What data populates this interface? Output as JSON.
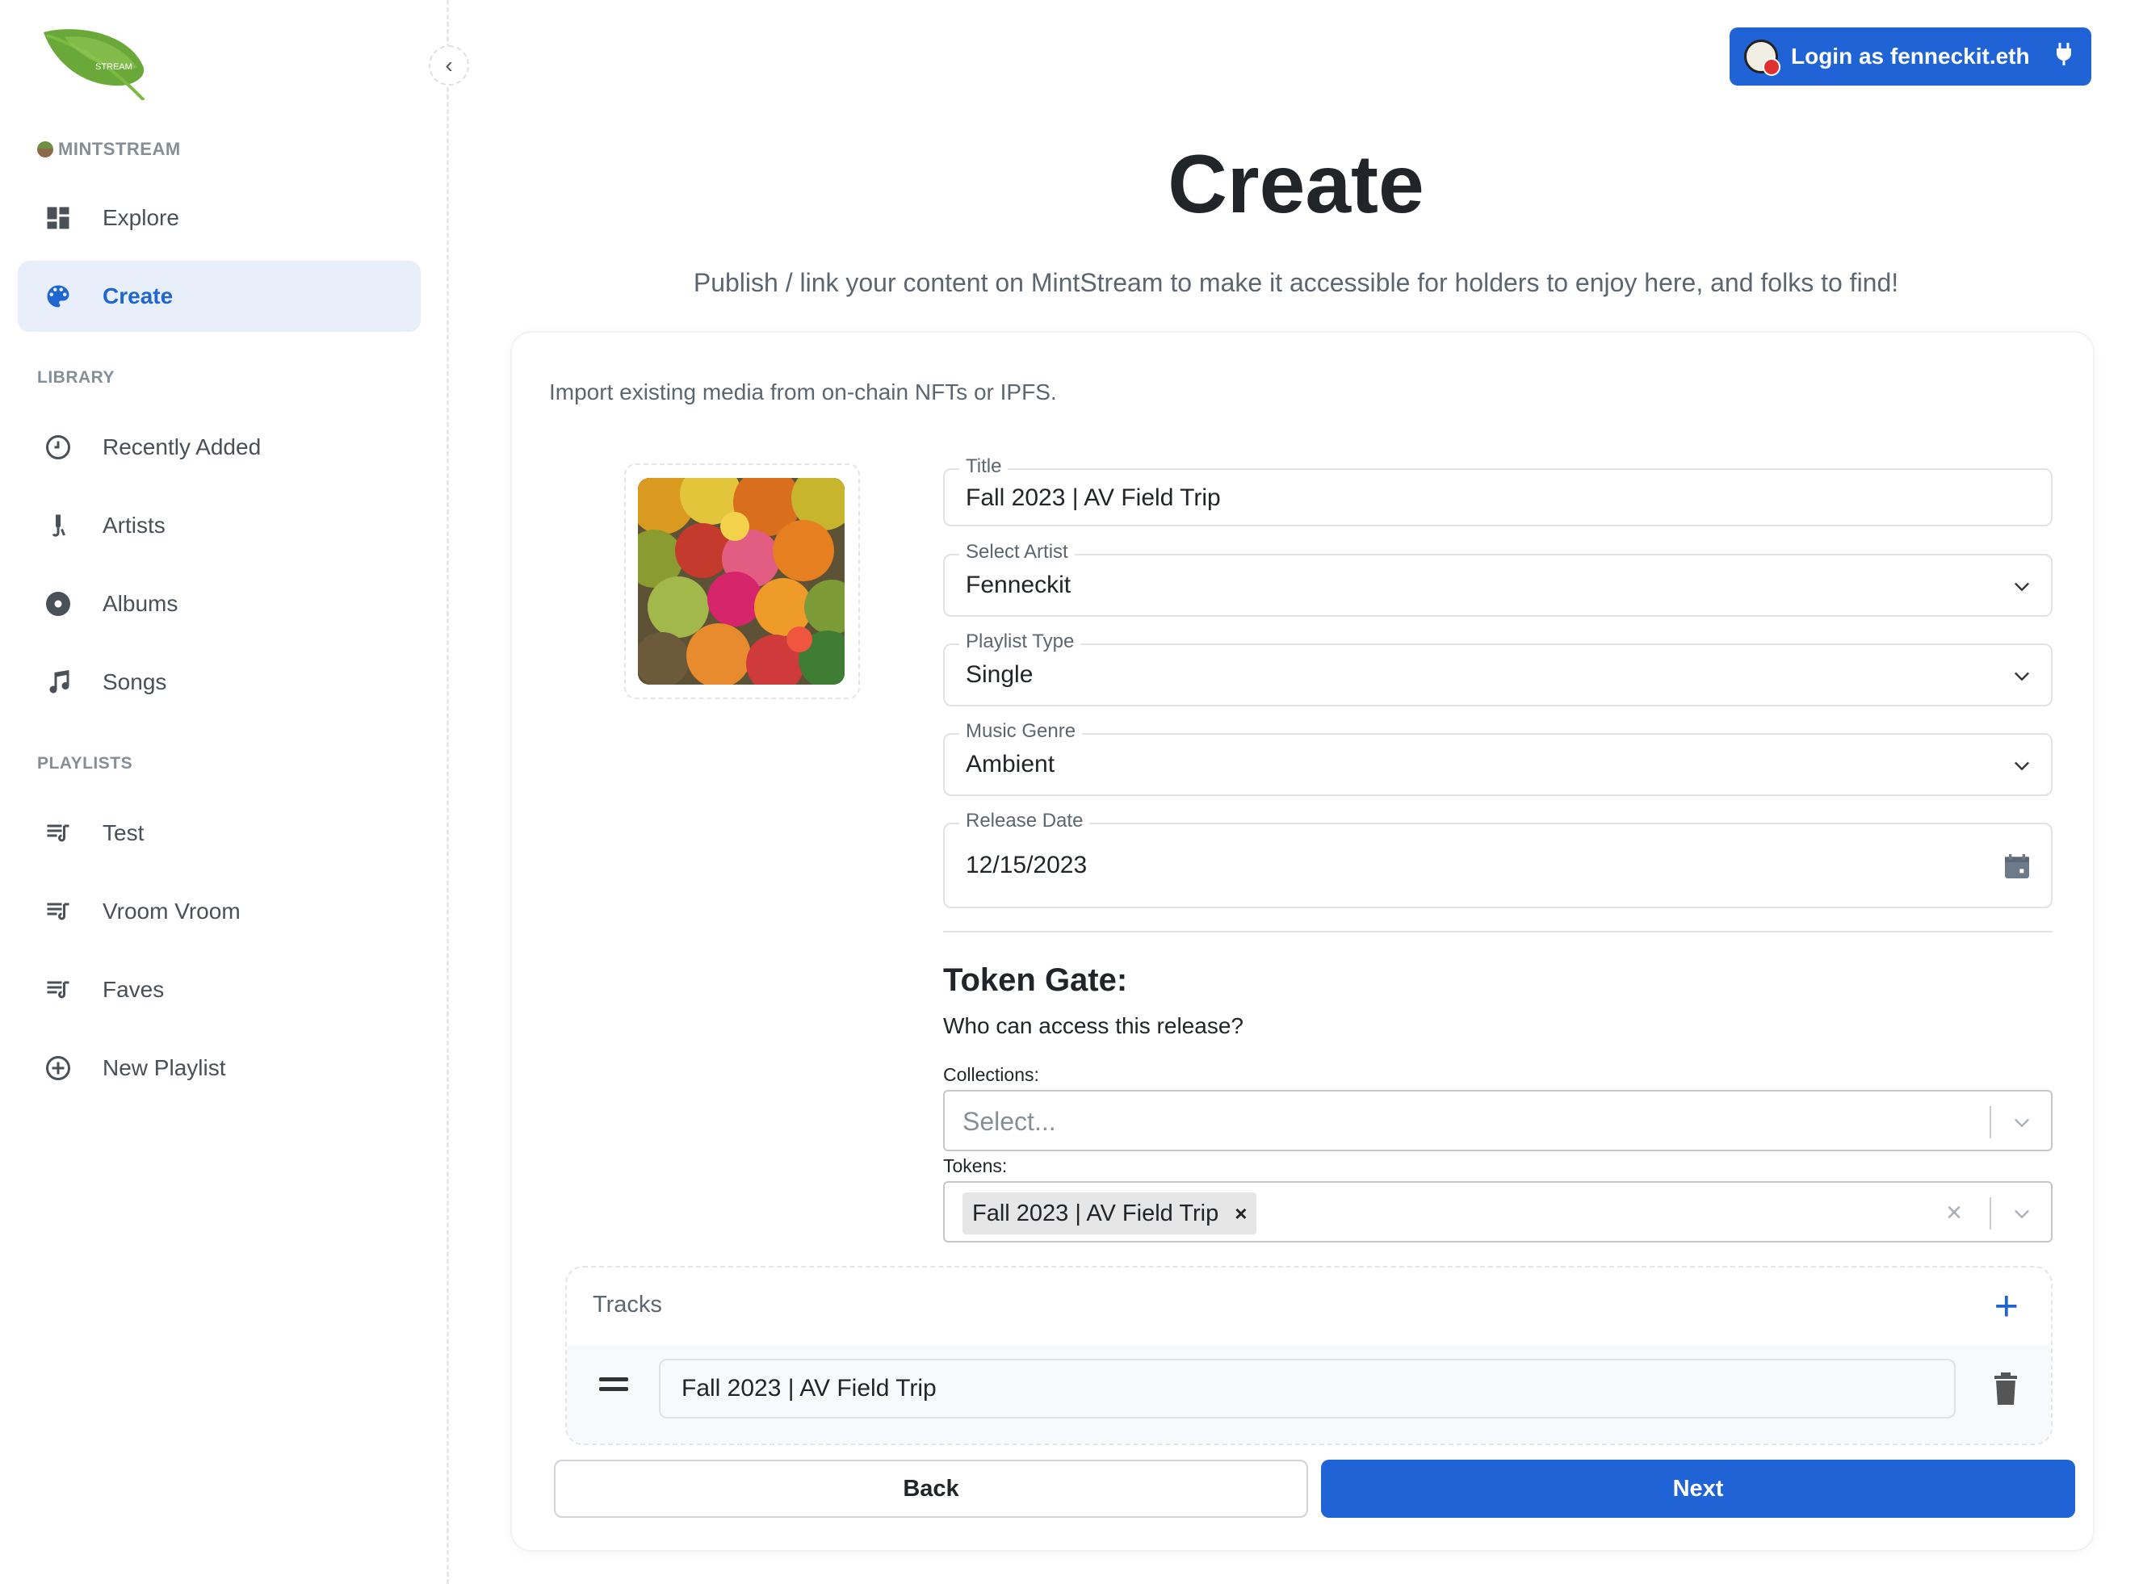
{
  "app": {
    "brand": "MINTSTREAM",
    "logo_text": "STREAM"
  },
  "sidebar": {
    "nav": [
      {
        "label": "Explore",
        "icon": "dashboard-icon",
        "active": false
      },
      {
        "label": "Create",
        "icon": "palette-icon",
        "active": true
      }
    ],
    "library_label": "LIBRARY",
    "library": [
      {
        "label": "Recently Added",
        "icon": "clock-icon"
      },
      {
        "label": "Artists",
        "icon": "microphone-icon"
      },
      {
        "label": "Albums",
        "icon": "disc-icon"
      },
      {
        "label": "Songs",
        "icon": "music-note-icon"
      }
    ],
    "playlists_label": "PLAYLISTS",
    "playlists": [
      {
        "label": "Test",
        "icon": "playlist-icon"
      },
      {
        "label": "Vroom Vroom",
        "icon": "playlist-icon"
      },
      {
        "label": "Faves",
        "icon": "playlist-icon"
      },
      {
        "label": "New Playlist",
        "icon": "plus-circle-icon"
      }
    ]
  },
  "header": {
    "login_label": "Login as fenneckit.eth"
  },
  "page": {
    "title": "Create",
    "subtitle": "Publish / link your content on MintStream to make it accessible for holders to enjoy here, and folks to find!",
    "import_text": "Import existing media from on-chain NFTs or IPFS."
  },
  "form": {
    "title": {
      "label": "Title",
      "value": "Fall 2023 | AV Field Trip"
    },
    "artist": {
      "label": "Select Artist",
      "value": "Fenneckit"
    },
    "playlist_type": {
      "label": "Playlist Type",
      "value": "Single"
    },
    "genre": {
      "label": "Music Genre",
      "value": "Ambient"
    },
    "release_date": {
      "label": "Release Date",
      "value": "12/15/2023"
    }
  },
  "token_gate": {
    "heading": "Token Gate:",
    "question": "Who can access this release?",
    "collections_label": "Collections:",
    "collections_placeholder": "Select...",
    "tokens_label": "Tokens:",
    "tokens_selected": [
      "Fall 2023 | AV Field Trip"
    ],
    "chip_remove": "×",
    "clear": "×"
  },
  "tracks": {
    "label": "Tracks",
    "add": "+",
    "items": [
      "Fall 2023 | AV Field Trip"
    ]
  },
  "buttons": {
    "back": "Back",
    "next": "Next"
  },
  "colors": {
    "accent": "#1f63d6",
    "active_bg": "#e8effa",
    "text": "#212529",
    "muted": "#868e96"
  }
}
